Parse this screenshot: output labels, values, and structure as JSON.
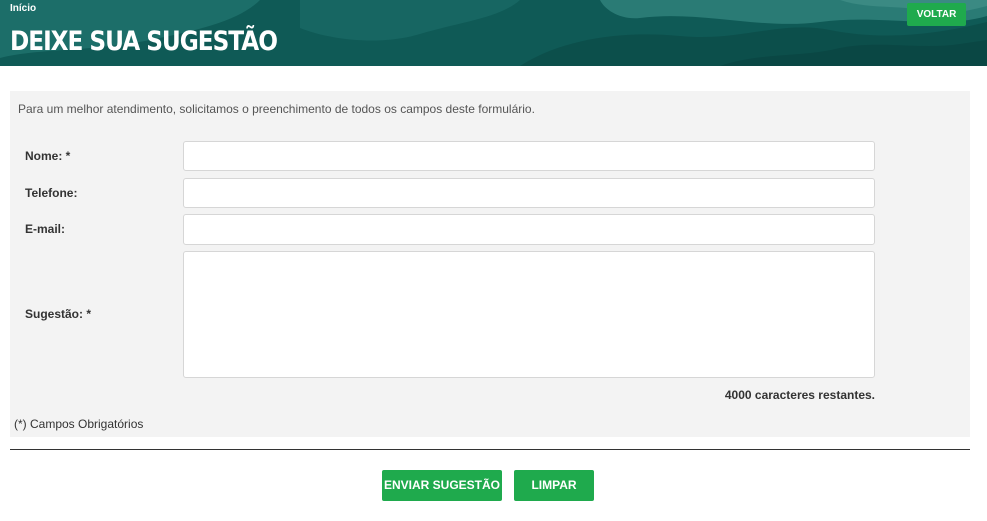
{
  "header": {
    "breadcrumb": "Início",
    "title": "DEIXE SUA SUGESTÃO",
    "back_label": "VOLTAR"
  },
  "form": {
    "intro": "Para um melhor atendimento, solicitamos o preenchimento de todos os campos deste formulário.",
    "fields": {
      "nome": {
        "label": "Nome:  *",
        "value": ""
      },
      "telefone": {
        "label": "Telefone:",
        "value": ""
      },
      "email": {
        "label": "E-mail:",
        "value": ""
      },
      "sugestao": {
        "label": "Sugestão: *",
        "value": ""
      }
    },
    "counter": {
      "count": "4000",
      "suffix": " caracteres restantes."
    },
    "required_note": "(*) Campos Obrigatórios"
  },
  "actions": {
    "submit_label": "ENVIAR SUGESTÃO",
    "clear_label": "LIMPAR"
  },
  "colors": {
    "header_bg": "#0f5a56",
    "accent_green": "#1faa4d",
    "panel_bg": "#f3f3f3"
  }
}
